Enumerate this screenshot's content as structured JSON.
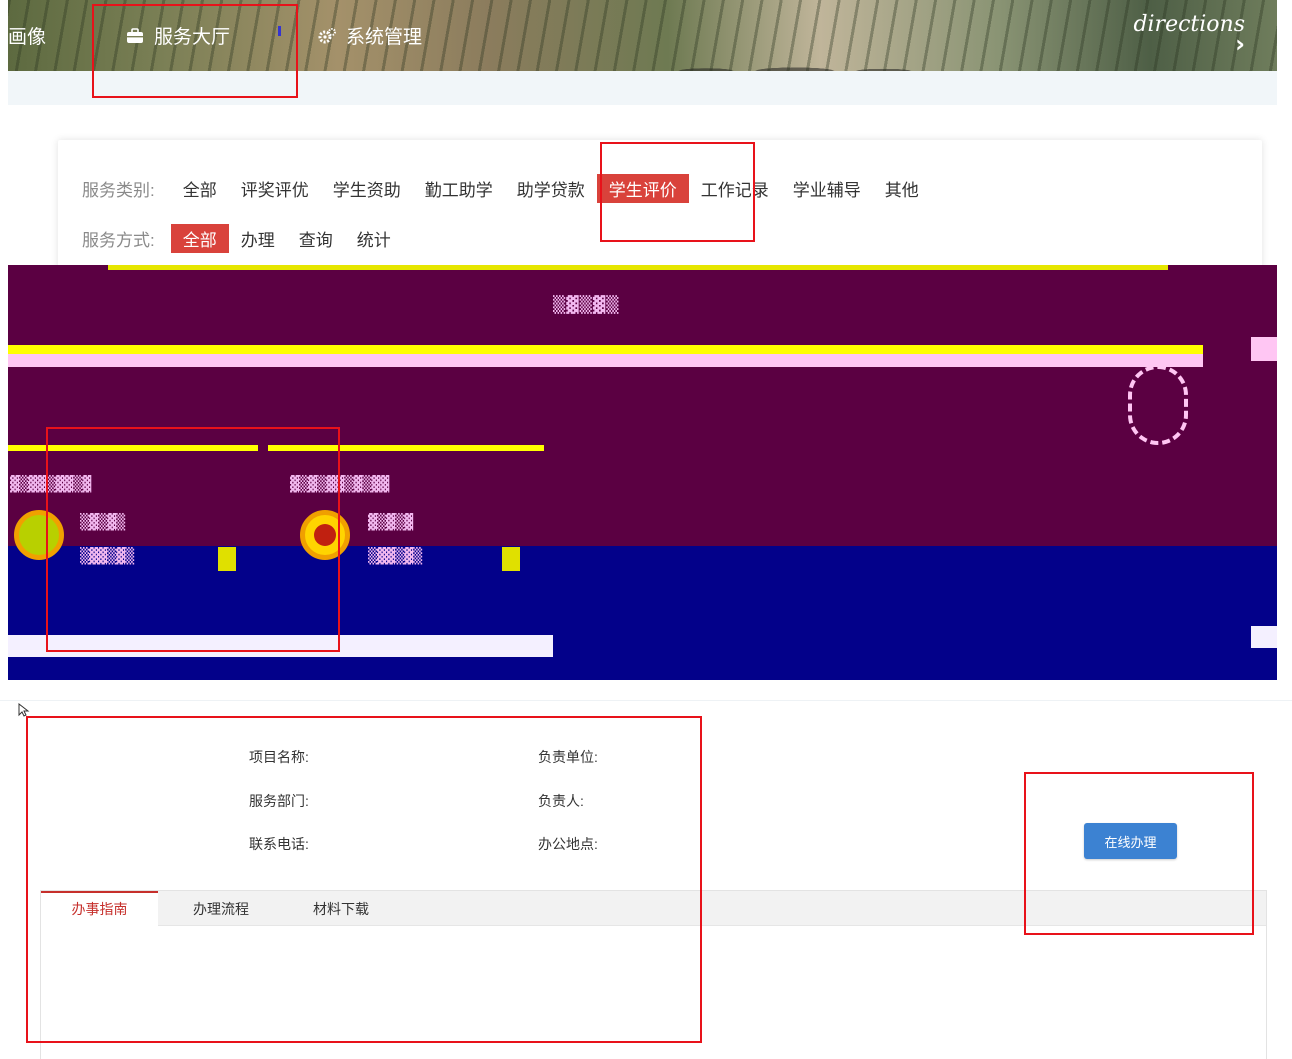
{
  "nav": {
    "portrait_label": "画像",
    "hall_label": "服务大厅",
    "system_label": "系统管理",
    "directions_text": "directions",
    "chevron": "›"
  },
  "filters": {
    "category": {
      "label": "服务类别:",
      "options": [
        "全部",
        "评奖评优",
        "学生资助",
        "勤工助学",
        "助学贷款",
        "学生评价",
        "工作记录",
        "学业辅导",
        "其他"
      ],
      "selected": "学生评价"
    },
    "mode": {
      "label": "服务方式:",
      "options": [
        "全部",
        "办理",
        "查询",
        "统计"
      ],
      "selected": "全部"
    }
  },
  "detail": {
    "project_name_label": "项目名称:",
    "service_dept_label": "服务部门:",
    "phone_label": "联系电话:",
    "responsible_unit_label": "负责单位:",
    "responsible_person_label": "负责人:",
    "office_location_label": "办公地点:",
    "online_button": "在线办理",
    "tabs": [
      "办事指南",
      "办理流程",
      "材料下载"
    ],
    "active_tab": "办事指南"
  },
  "colors": {
    "accent_red": "#d9423b",
    "button_blue": "#3c82d2",
    "annotation_red": "#e8121a"
  }
}
